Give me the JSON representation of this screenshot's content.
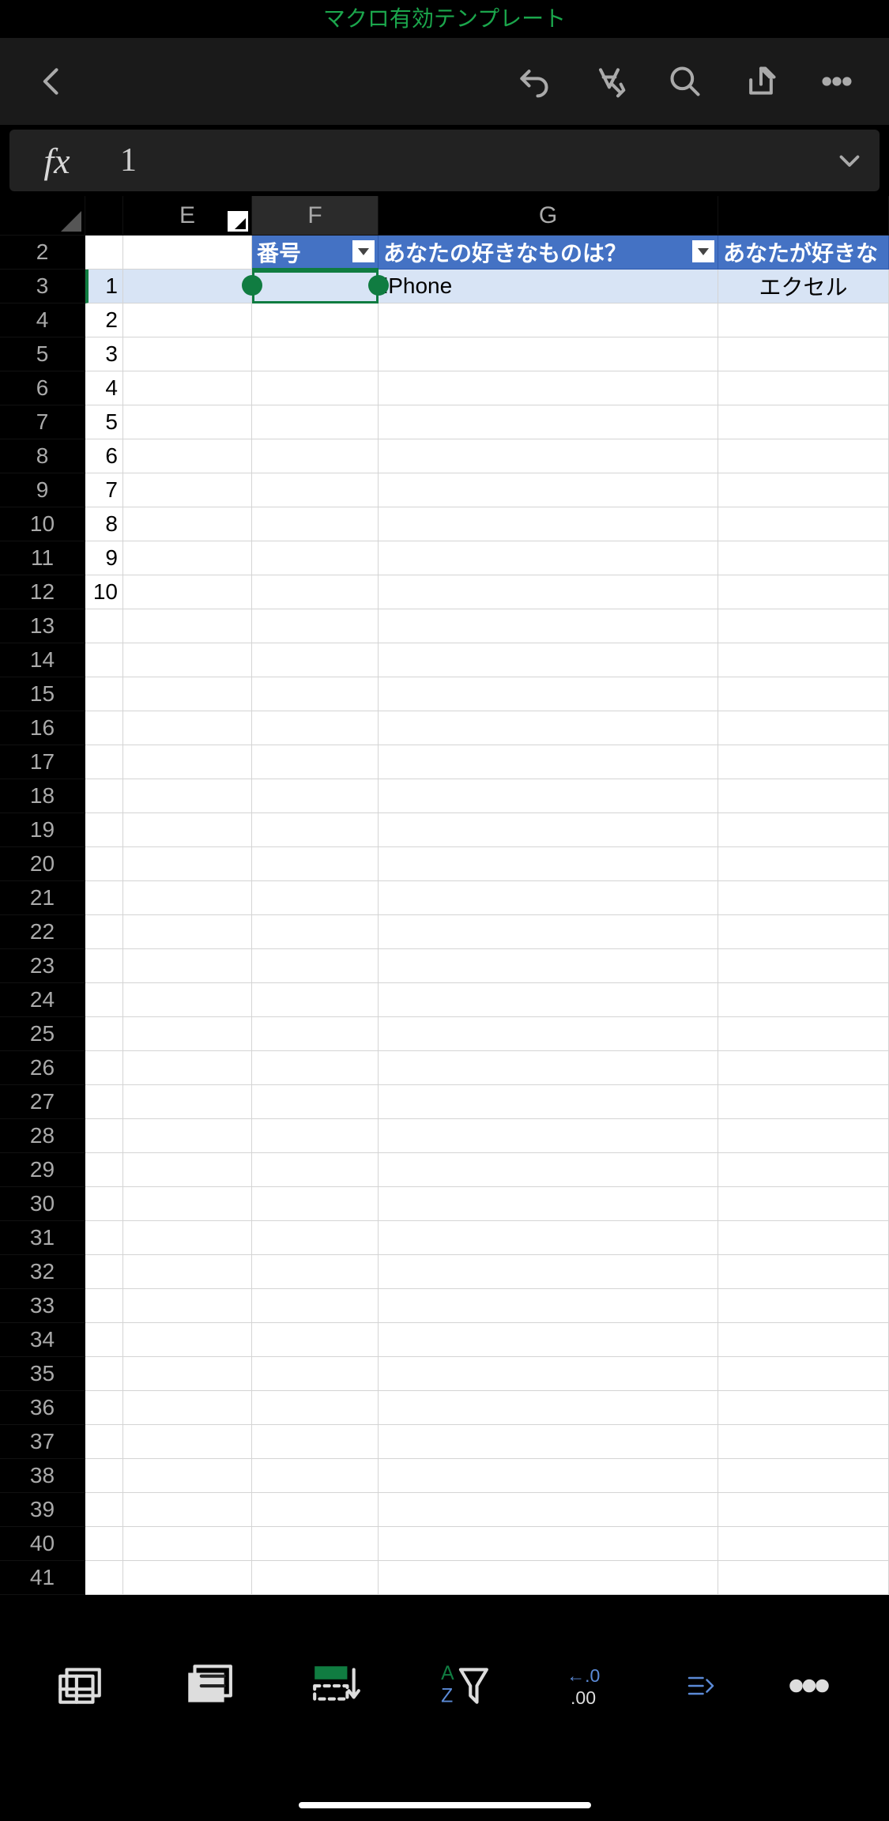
{
  "header": {
    "title": "マクロ有効テンプレート"
  },
  "formula": {
    "fx_label": "fx",
    "value": "1"
  },
  "columns": {
    "blank_label": "",
    "E": "E",
    "F": "F",
    "G": "G",
    "H_label": ""
  },
  "table_headers": {
    "F": "番号",
    "G": "あなたの好きなものは？",
    "H": "あなたが好きな"
  },
  "data_row3": {
    "D": "1",
    "G": "iPhone",
    "H": "エクセル"
  },
  "row_numbers": [
    "2",
    "3",
    "4",
    "5",
    "6",
    "7",
    "8",
    "9",
    "10",
    "11",
    "12",
    "13",
    "14",
    "15",
    "16",
    "17",
    "18",
    "19",
    "20",
    "21",
    "22",
    "23",
    "24",
    "25",
    "26",
    "27",
    "28",
    "29",
    "30",
    "31",
    "32",
    "33",
    "34",
    "35",
    "36",
    "37",
    "38",
    "39",
    "40",
    "41"
  ],
  "colD_values": [
    "",
    "1",
    "2",
    "3",
    "4",
    "5",
    "6",
    "7",
    "8",
    "9",
    "10",
    "",
    "",
    "",
    "",
    "",
    "",
    "",
    "",
    "",
    "",
    "",
    "",
    "",
    "",
    "",
    "",
    "",
    "",
    "",
    "",
    "",
    "",
    "",
    "",
    "",
    "",
    "",
    "",
    ""
  ],
  "bottom_labels": {
    "az": "A",
    "az2": "Z",
    "num1": "←.0",
    "num2": ".00"
  }
}
